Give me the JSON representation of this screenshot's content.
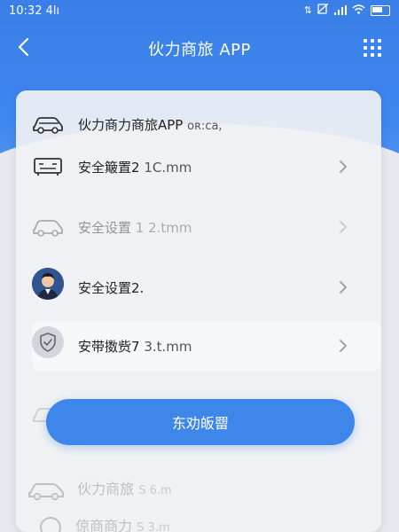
{
  "status_bar": {
    "time": "10:32 4lı",
    "icons": [
      "data-arrows-icon",
      "no-sim-icon",
      "signal-icon",
      "wifi-icon",
      "battery-icon"
    ]
  },
  "nav": {
    "title": "伙力商旅 APP",
    "back_icon": "chevron-left-icon",
    "menu_icon": "grid-menu-icon"
  },
  "rows": [
    {
      "label": "伙力商力商旅APP",
      "value": "oʀ:ca,",
      "icon": "car-icon"
    },
    {
      "label": "安全簸置2",
      "value": "1C.mm",
      "icon": "bus-icon"
    },
    {
      "label": "安全设置",
      "value": "1 2.tmm",
      "icon": "car-icon"
    },
    {
      "label": "安全设置2.",
      "value": "",
      "icon": "avatar"
    },
    {
      "label": "安带擞赀7",
      "value": "3.t.mm",
      "icon": "shield-check-icon"
    }
  ],
  "primary_button": {
    "label": "东劝皈罶"
  },
  "background_items": [
    {
      "label": "伙力商旅",
      "value": "S 6.m"
    },
    {
      "label": "倞商商力",
      "value": "S 3.m"
    }
  ],
  "colors": {
    "header_blue": "#3a7fe8",
    "button_blue": "#3f86ea",
    "panel_bg": "#f0f1f4"
  }
}
